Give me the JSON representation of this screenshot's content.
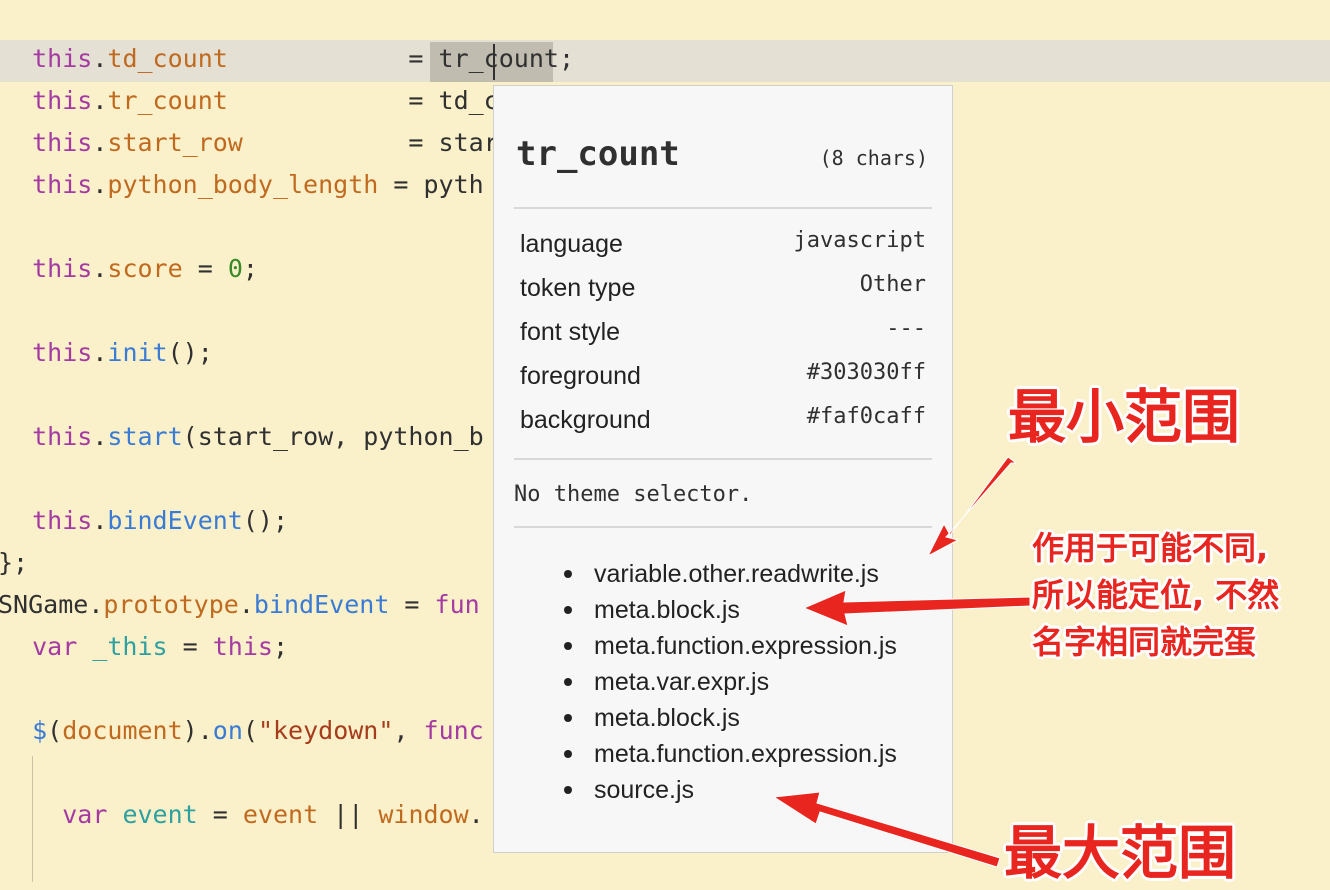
{
  "code_lines": [
    {
      "parts": [
        {
          "t": "  "
        },
        {
          "t": "this",
          "c": "kw"
        },
        {
          "t": "."
        },
        {
          "t": "td_count",
          "c": "var"
        },
        {
          "t": "            = tr_count;"
        }
      ]
    },
    {
      "parts": [
        {
          "t": "  "
        },
        {
          "t": "this",
          "c": "kw"
        },
        {
          "t": "."
        },
        {
          "t": "tr_count",
          "c": "var"
        },
        {
          "t": "            = td_c"
        }
      ]
    },
    {
      "parts": [
        {
          "t": "  "
        },
        {
          "t": "this",
          "c": "kw"
        },
        {
          "t": "."
        },
        {
          "t": "start_row",
          "c": "var"
        },
        {
          "t": "           = star"
        }
      ]
    },
    {
      "parts": [
        {
          "t": "  "
        },
        {
          "t": "this",
          "c": "kw"
        },
        {
          "t": "."
        },
        {
          "t": "python_body_length",
          "c": "var"
        },
        {
          "t": " = pyth"
        }
      ]
    },
    {
      "parts": [
        {
          "t": "  "
        },
        {
          "t": "this",
          "c": "kw"
        },
        {
          "t": "."
        },
        {
          "t": "score",
          "c": "var"
        },
        {
          "t": " = "
        },
        {
          "t": "0",
          "c": "num"
        },
        {
          "t": ";"
        }
      ]
    },
    {
      "parts": [
        {
          "t": "  "
        },
        {
          "t": "this",
          "c": "kw"
        },
        {
          "t": "."
        },
        {
          "t": "init",
          "c": "fn"
        },
        {
          "t": "();"
        }
      ]
    },
    {
      "parts": [
        {
          "t": "  "
        },
        {
          "t": "this",
          "c": "kw"
        },
        {
          "t": "."
        },
        {
          "t": "start",
          "c": "fn"
        },
        {
          "t": "(start_row, python_b"
        }
      ]
    },
    {
      "parts": [
        {
          "t": "  "
        },
        {
          "t": "this",
          "c": "kw"
        },
        {
          "t": "."
        },
        {
          "t": "bindEvent",
          "c": "fn"
        },
        {
          "t": "();"
        }
      ]
    },
    {
      "parts": [
        {
          "t": "};"
        }
      ]
    },
    {
      "parts": [
        {
          "t": "SNGame"
        },
        {
          "t": "."
        },
        {
          "t": "prototype",
          "c": "var"
        },
        {
          "t": "."
        },
        {
          "t": "bindEvent",
          "c": "fn"
        },
        {
          "t": " = "
        },
        {
          "t": "fun",
          "c": "kw"
        }
      ]
    },
    {
      "parts": [
        {
          "t": "  "
        },
        {
          "t": "var",
          "c": "kw"
        },
        {
          "t": " "
        },
        {
          "t": "_this",
          "c": "vdef"
        },
        {
          "t": " = "
        },
        {
          "t": "this",
          "c": "kw"
        },
        {
          "t": ";"
        }
      ]
    },
    {
      "parts": [
        {
          "t": "  "
        },
        {
          "t": "$",
          "c": "fn"
        },
        {
          "t": "("
        },
        {
          "t": "document",
          "c": "var"
        },
        {
          "t": ")."
        },
        {
          "t": "on",
          "c": "fn"
        },
        {
          "t": "("
        },
        {
          "t": "\"keydown\"",
          "c": "str"
        },
        {
          "t": ", "
        },
        {
          "t": "func",
          "c": "kw"
        }
      ]
    },
    {
      "parts": [
        {
          "t": "    "
        },
        {
          "t": "var",
          "c": "kw"
        },
        {
          "t": " "
        },
        {
          "t": "event",
          "c": "vdef"
        },
        {
          "t": " = "
        },
        {
          "t": "event",
          "c": "var"
        },
        {
          "t": " || "
        },
        {
          "t": "window",
          "c": "var"
        },
        {
          "t": "."
        }
      ]
    }
  ],
  "popup": {
    "token": "tr_count",
    "chars": "(8 chars)",
    "rows": [
      {
        "key": "language",
        "value": "javascript"
      },
      {
        "key": "token type",
        "value": "Other"
      },
      {
        "key": "font style",
        "value": "---"
      },
      {
        "key": "foreground",
        "value": "#303030ff"
      },
      {
        "key": "background",
        "value": "#faf0caff"
      }
    ],
    "no_theme": "No theme selector.",
    "scopes": [
      "variable.other.readwrite.js",
      "meta.block.js",
      "meta.function.expression.js",
      "meta.var.expr.js",
      "meta.block.js",
      "meta.function.expression.js",
      "source.js"
    ]
  },
  "annotations": {
    "min_scope": "最小范围",
    "note_lines": [
      "作用于可能不同,",
      "所以能定位, 不然",
      "名字相同就完蛋"
    ],
    "max_scope": "最大范围"
  },
  "colors": {
    "background": "#faf0ca",
    "foreground": "#303030",
    "keyword": "#a53aa3",
    "variable": "#c06a20",
    "function": "#3a7bd5",
    "number": "#3a8a2a",
    "annotation": "#e8251f"
  }
}
